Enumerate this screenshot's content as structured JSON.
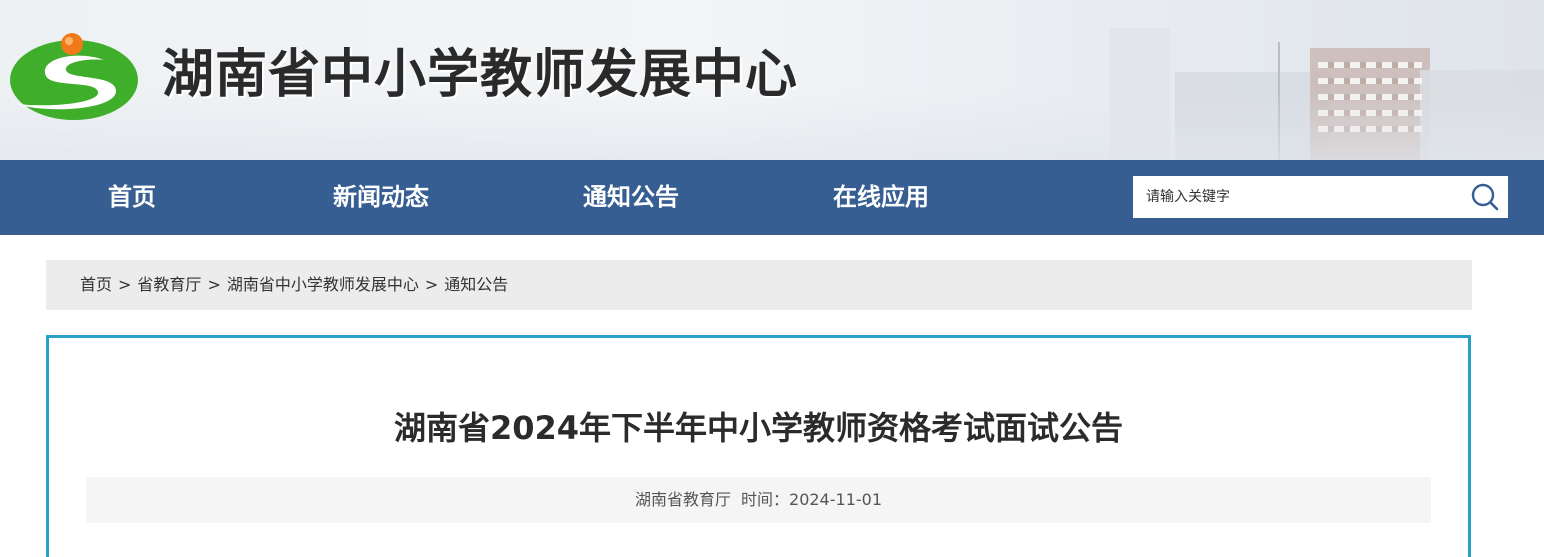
{
  "header": {
    "site_title": "湖南省中小学教师发展中心",
    "logo_icon": "school-logo-icon"
  },
  "nav": {
    "items": [
      {
        "label": "首页"
      },
      {
        "label": "新闻动态"
      },
      {
        "label": "通知公告"
      },
      {
        "label": "在线应用"
      }
    ],
    "search": {
      "placeholder": "请输入关键字",
      "icon": "search-icon"
    }
  },
  "breadcrumb": {
    "items": [
      "首页",
      "省教育厅",
      "湖南省中小学教师发展中心",
      "通知公告"
    ],
    "separator": ">"
  },
  "article": {
    "title": "湖南省2024年下半年中小学教师资格考试面试公告",
    "source": "湖南省教育厅",
    "time_label": "时间：",
    "date": "2024-11-01"
  },
  "colors": {
    "nav_bg": "#365e92",
    "article_border": "#2aa0c8",
    "logo_green": "#3fae2a",
    "logo_orange": "#f07a1a"
  }
}
